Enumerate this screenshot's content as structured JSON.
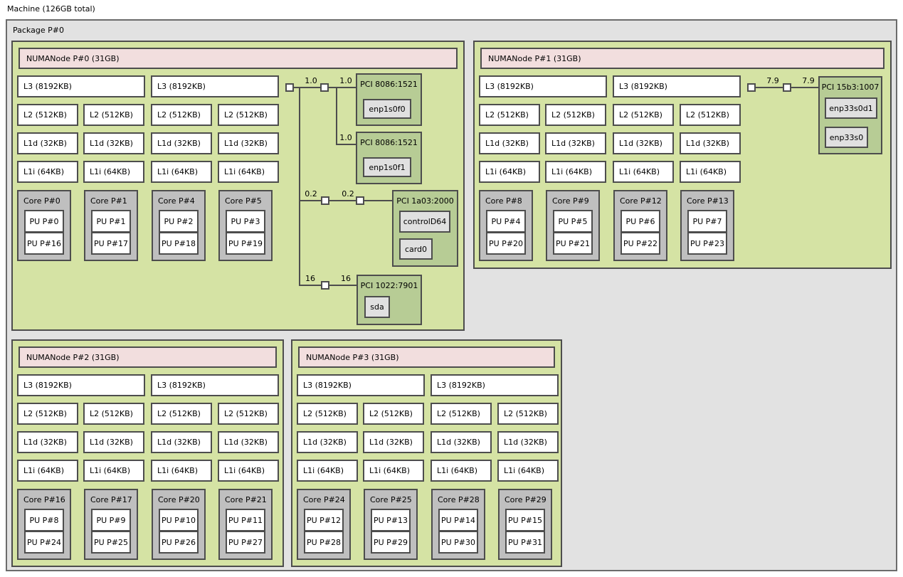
{
  "machine_label": "Machine (126GB total)",
  "package_label": "Package P#0",
  "colors": {
    "package_gray": "#e2e2e2",
    "package_border": "#6b6b6b",
    "container_green": "#d5e3a4",
    "numa_pink": "#f2dede",
    "pci_green": "#b7cc95",
    "core_gray": "#bfbfbf",
    "os_gray": "#e0e0e0",
    "border_dark": "#4d4d4d"
  },
  "numa_nodes": [
    {
      "label": "NUMANode P#0 (31GB)",
      "l3": [
        "L3 (8192KB)",
        "L3 (8192KB)"
      ],
      "l2": [
        "L2 (512KB)",
        "L2 (512KB)",
        "L2 (512KB)",
        "L2 (512KB)"
      ],
      "l1d": [
        "L1d (32KB)",
        "L1d (32KB)",
        "L1d (32KB)",
        "L1d (32KB)"
      ],
      "l1i": [
        "L1i (64KB)",
        "L1i (64KB)",
        "L1i (64KB)",
        "L1i (64KB)"
      ],
      "cores": [
        {
          "label": "Core P#0",
          "pus": [
            "PU P#0",
            "PU P#16"
          ]
        },
        {
          "label": "Core P#1",
          "pus": [
            "PU P#1",
            "PU P#17"
          ]
        },
        {
          "label": "Core P#4",
          "pus": [
            "PU P#2",
            "PU P#18"
          ]
        },
        {
          "label": "Core P#5",
          "pus": [
            "PU P#3",
            "PU P#19"
          ]
        }
      ]
    },
    {
      "label": "NUMANode P#1 (31GB)",
      "l3": [
        "L3 (8192KB)",
        "L3 (8192KB)"
      ],
      "l2": [
        "L2 (512KB)",
        "L2 (512KB)",
        "L2 (512KB)",
        "L2 (512KB)"
      ],
      "l1d": [
        "L1d (32KB)",
        "L1d (32KB)",
        "L1d (32KB)",
        "L1d (32KB)"
      ],
      "l1i": [
        "L1i (64KB)",
        "L1i (64KB)",
        "L1i (64KB)",
        "L1i (64KB)"
      ],
      "cores": [
        {
          "label": "Core P#8",
          "pus": [
            "PU P#4",
            "PU P#20"
          ]
        },
        {
          "label": "Core P#9",
          "pus": [
            "PU P#5",
            "PU P#21"
          ]
        },
        {
          "label": "Core P#12",
          "pus": [
            "PU P#6",
            "PU P#22"
          ]
        },
        {
          "label": "Core P#13",
          "pus": [
            "PU P#7",
            "PU P#23"
          ]
        }
      ]
    },
    {
      "label": "NUMANode P#2 (31GB)",
      "l3": [
        "L3 (8192KB)",
        "L3 (8192KB)"
      ],
      "l2": [
        "L2 (512KB)",
        "L2 (512KB)",
        "L2 (512KB)",
        "L2 (512KB)"
      ],
      "l1d": [
        "L1d (32KB)",
        "L1d (32KB)",
        "L1d (32KB)",
        "L1d (32KB)"
      ],
      "l1i": [
        "L1i (64KB)",
        "L1i (64KB)",
        "L1i (64KB)",
        "L1i (64KB)"
      ],
      "cores": [
        {
          "label": "Core P#16",
          "pus": [
            "PU P#8",
            "PU P#24"
          ]
        },
        {
          "label": "Core P#17",
          "pus": [
            "PU P#9",
            "PU P#25"
          ]
        },
        {
          "label": "Core P#20",
          "pus": [
            "PU P#10",
            "PU P#26"
          ]
        },
        {
          "label": "Core P#21",
          "pus": [
            "PU P#11",
            "PU P#27"
          ]
        }
      ]
    },
    {
      "label": "NUMANode P#3 (31GB)",
      "l3": [
        "L3 (8192KB)",
        "L3 (8192KB)"
      ],
      "l2": [
        "L2 (512KB)",
        "L2 (512KB)",
        "L2 (512KB)",
        "L2 (512KB)"
      ],
      "l1d": [
        "L1d (32KB)",
        "L1d (32KB)",
        "L1d (32KB)",
        "L1d (32KB)"
      ],
      "l1i": [
        "L1i (64KB)",
        "L1i (64KB)",
        "L1i (64KB)",
        "L1i (64KB)"
      ],
      "cores": [
        {
          "label": "Core P#24",
          "pus": [
            "PU P#12",
            "PU P#28"
          ]
        },
        {
          "label": "Core P#25",
          "pus": [
            "PU P#13",
            "PU P#29"
          ]
        },
        {
          "label": "Core P#28",
          "pus": [
            "PU P#14",
            "PU P#30"
          ]
        },
        {
          "label": "Core P#29",
          "pus": [
            "PU P#15",
            "PU P#31"
          ]
        }
      ]
    }
  ],
  "pci_node0": {
    "links": {
      "up1": "1.0",
      "dev1": "1.0",
      "dev2": "1.0",
      "up2": "0.2",
      "dev3": "0.2",
      "up3": "16",
      "dev4": "16"
    },
    "devices": [
      {
        "title": "PCI 8086:1521",
        "os_devices": [
          "enp1s0f0"
        ]
      },
      {
        "title": "PCI 8086:1521",
        "os_devices": [
          "enp1s0f1"
        ]
      },
      {
        "title": "PCI 1a03:2000",
        "os_devices": [
          "controlD64",
          "card0"
        ]
      },
      {
        "title": "PCI 1022:7901",
        "os_devices": [
          "sda"
        ]
      }
    ]
  },
  "pci_node1": {
    "links": {
      "up1": "7.9",
      "dev1": "7.9"
    },
    "devices": [
      {
        "title": "PCI 15b3:1007",
        "os_devices": [
          "enp33s0d1",
          "enp33s0"
        ]
      }
    ]
  }
}
